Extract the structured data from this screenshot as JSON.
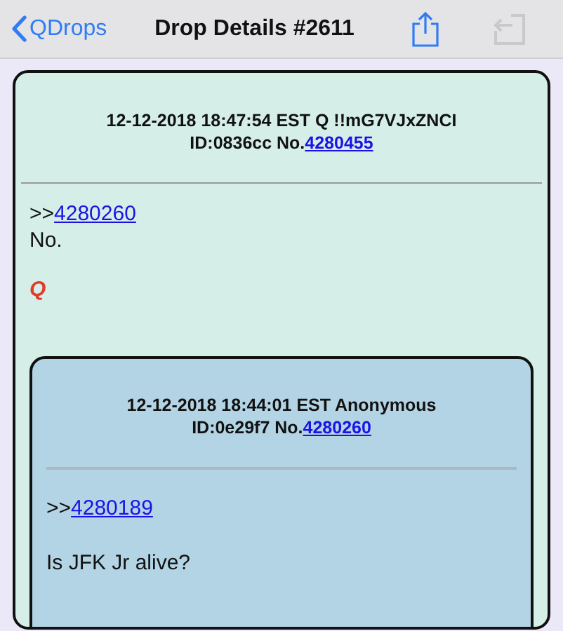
{
  "nav": {
    "back": "QDrops",
    "title": "Drop Details #2611",
    "actions": [
      {
        "kind": "share",
        "disabled": false
      },
      {
        "kind": "undo",
        "disabled": true
      }
    ]
  },
  "post": {
    "header": [
      {
        "text": "12-12-2018 18:47:54 EST Q !!mG7VJxZNCI"
      },
      {
        "text": "ID:0836cc No.",
        "link": "4280455"
      }
    ],
    "body": [
      {
        "kind": "reply",
        "text": ">>",
        "link": "4280260"
      },
      {
        "kind": "text",
        "text": "No."
      },
      {
        "kind": "signature",
        "text": "Q"
      }
    ],
    "quote": {
      "header": [
        {
          "text": "12-12-2018 18:44:01 EST Anonymous"
        },
        {
          "text": "ID:0e29f7 No.",
          "link": "4280260"
        }
      ],
      "body": [
        {
          "kind": "reply",
          "text": ">>",
          "link": "4280189"
        },
        {
          "kind": "text",
          "text": "Is JFK Jr alive?"
        }
      ]
    }
  }
}
